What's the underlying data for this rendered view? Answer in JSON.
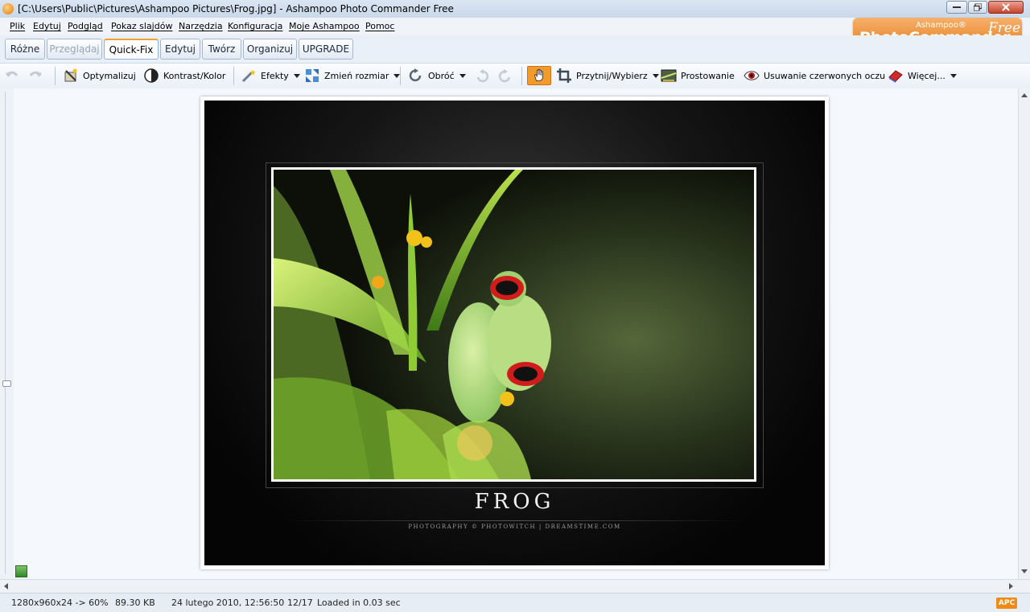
{
  "window": {
    "title": "[C:\\Users\\Public\\Pictures\\Ashampoo Pictures\\Frog.jpg] - Ashampoo Photo Commander Free"
  },
  "menu": [
    "Plik",
    "Edytuj",
    "Podgląd",
    "Pokaz slajdów",
    "Narzędzia",
    "Konfiguracja",
    "Moje Ashampoo",
    "Pomoc"
  ],
  "logo": {
    "brand_small": "Ashampoo®",
    "brand_big": "PhotoCommander",
    "brand_free": "Free"
  },
  "tabs": [
    {
      "label": "Różne",
      "state": "normal"
    },
    {
      "label": "Przeglądaj",
      "state": "disabled"
    },
    {
      "label": "Quick-Fix",
      "state": "active"
    },
    {
      "label": "Edytuj",
      "state": "normal"
    },
    {
      "label": "Twórz",
      "state": "normal"
    },
    {
      "label": "Organizuj",
      "state": "normal"
    },
    {
      "label": "UPGRADE",
      "state": "normal"
    }
  ],
  "toolbar": {
    "optimize": "Optymalizuj",
    "contrast": "Kontrast/Kolor",
    "effects": "Efekty",
    "resize": "Zmień rozmiar",
    "rotate": "Obróć",
    "crop": "Przytnij/Wybierz",
    "straighten": "Prostowanie",
    "redeye": "Usuwanie czerwonych oczu",
    "more": "Więcej..."
  },
  "photo": {
    "caption": "FROG",
    "credit": "PHOTOGRAPHY © PHOTOWITCH | DREAMSTIME.COM"
  },
  "status": {
    "dimensions": "1280x960x24 -> 60%",
    "filesize": "89.30 KB",
    "date": "24 lutego 2010, 12:56:50",
    "index": "12/17",
    "load": "Loaded in 0.03 sec",
    "badge": "APC"
  },
  "colors": {
    "accent": "#f0a030",
    "logo": "#e27f1f"
  }
}
